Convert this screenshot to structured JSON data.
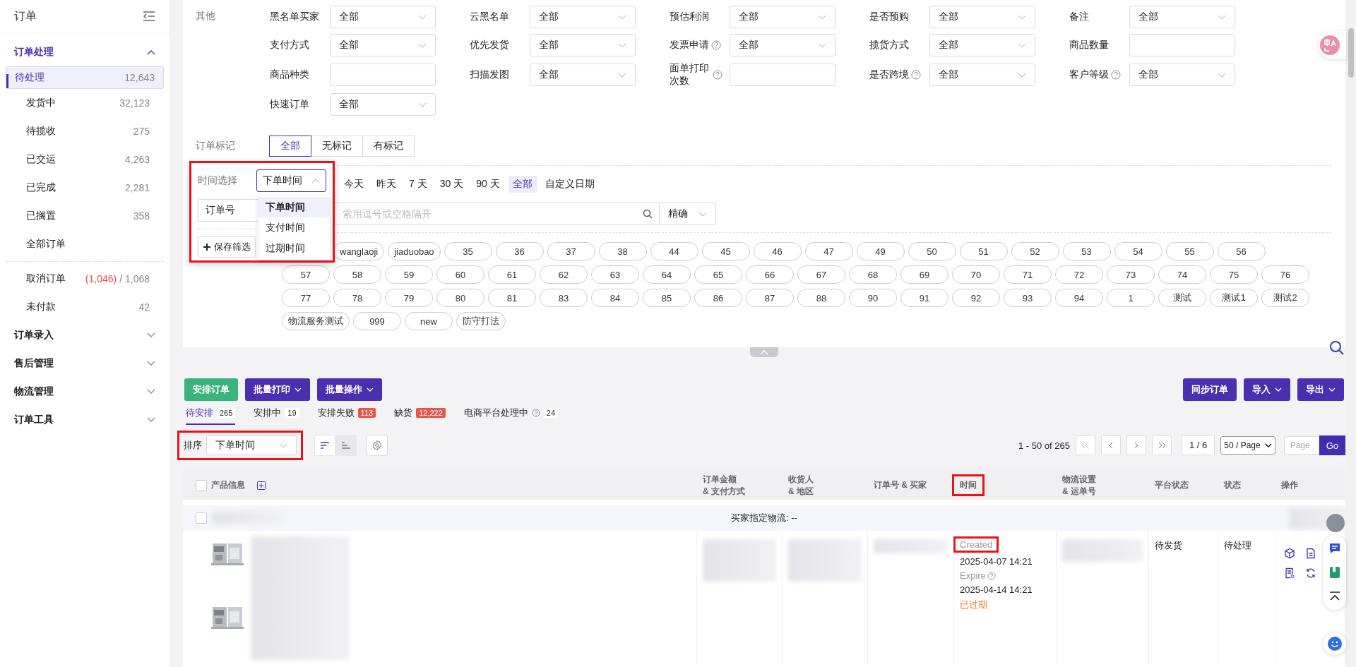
{
  "sidebar": {
    "title": "订单",
    "sections": [
      {
        "label": "订单处理",
        "expanded": true,
        "groups": [
          [
            {
              "label": "待处理",
              "count": "12,643",
              "selected": true
            },
            {
              "label": "发货中",
              "count": "32,123",
              "selected": false
            },
            {
              "label": "待揽收",
              "count": "275",
              "selected": false
            },
            {
              "label": "已交运",
              "count": "4,263",
              "selected": false
            },
            {
              "label": "已完成",
              "count": "2,281",
              "selected": false
            },
            {
              "label": "已搁置",
              "count": "358",
              "selected": false
            },
            {
              "label": "全部订单",
              "selected": false
            }
          ],
          [
            {
              "label": "取消订单",
              "alert_count": "(1,046)",
              "count": "/ 1,068",
              "selected": false
            },
            {
              "label": "未付款",
              "count": "42",
              "selected": false
            }
          ]
        ]
      },
      {
        "label": "订单录入",
        "expanded": false
      },
      {
        "label": "售后管理",
        "expanded": false
      },
      {
        "label": "物流管理",
        "expanded": false
      },
      {
        "label": "订单工具",
        "expanded": false
      }
    ]
  },
  "filters": {
    "group_label": "其他",
    "fields": [
      {
        "label": "黑名单买家",
        "kind": "select",
        "value": "全部",
        "help": false
      },
      {
        "label": "云黑名单",
        "kind": "select",
        "value": "全部",
        "help": false
      },
      {
        "label": "预估利润",
        "kind": "select",
        "value": "全部",
        "help": false
      },
      {
        "label": "是否预购",
        "kind": "select",
        "value": "全部",
        "help": false
      },
      {
        "label": "备注",
        "kind": "select",
        "value": "全部",
        "help": false
      },
      {
        "label": "支付方式",
        "kind": "select",
        "value": "全部",
        "help": false
      },
      {
        "label": "优先发货",
        "kind": "select",
        "value": "全部",
        "help": false
      },
      {
        "label": "发票申请",
        "kind": "select",
        "value": "全部",
        "help": true
      },
      {
        "label": "揽货方式",
        "kind": "select",
        "value": "全部",
        "help": false
      },
      {
        "label": "商品数量",
        "kind": "input",
        "help": false
      },
      {
        "label": "商品种类",
        "kind": "input",
        "help": false
      },
      {
        "label": "扫描发图",
        "kind": "select",
        "value": "全部",
        "help": false
      },
      {
        "label": "面单打印次数",
        "kind": "input",
        "help": true
      },
      {
        "label": "是否跨境",
        "kind": "select",
        "value": "全部",
        "help": true
      },
      {
        "label": "客户等级",
        "kind": "select",
        "value": "全部",
        "help": true
      },
      {
        "label": "快速订单",
        "kind": "select",
        "value": "全部",
        "help": false
      }
    ]
  },
  "order_marks": {
    "label": "订单标记",
    "options": [
      {
        "label": "全部",
        "selected": true
      },
      {
        "label": "无标记",
        "selected": false
      },
      {
        "label": "有标记",
        "selected": false
      }
    ]
  },
  "time_popup": {
    "label": "时间选择",
    "value": "下单时间",
    "expanded": true,
    "highlighted": true,
    "options": [
      {
        "label": "下单时间",
        "selected": true
      },
      {
        "label": "支付时间",
        "selected": false
      },
      {
        "label": "过期时间",
        "selected": false
      }
    ],
    "search_type": "订单号",
    "save_button": "保存筛选"
  },
  "time_ranges": [
    {
      "label": "今天",
      "selected": false
    },
    {
      "label": "昨天",
      "selected": false
    },
    {
      "label": "7 天",
      "selected": false
    },
    {
      "label": "30 天",
      "selected": false
    },
    {
      "label": "90 天",
      "selected": false
    },
    {
      "label": "全部",
      "selected": true
    },
    {
      "label": "自定义日期",
      "selected": false
    }
  ],
  "search": {
    "placeholder": "索用逗号或空格隔开",
    "match": "精确"
  },
  "tag_rows": [
    [
      "wanglaoji",
      "jiaduobao",
      "35",
      "36",
      "37",
      "38",
      "44",
      "45",
      "46",
      "47",
      "49",
      "50",
      "51",
      "52",
      "53",
      "54",
      "55",
      "56"
    ],
    [
      "57",
      "58",
      "59",
      "60",
      "61",
      "62",
      "63",
      "64",
      "65",
      "66",
      "67",
      "68",
      "69",
      "70",
      "71",
      "72",
      "73",
      "74",
      "75",
      "76"
    ],
    [
      "77",
      "78",
      "79",
      "80",
      "81",
      "83",
      "84",
      "85",
      "86",
      "87",
      "88",
      "90",
      "91",
      "92",
      "93",
      "94",
      "1",
      "测试",
      "测试1",
      "测试2"
    ],
    [
      "物流服务测试",
      "999",
      "new",
      "防守打法"
    ]
  ],
  "actions": {
    "left": [
      {
        "label": "安排订单",
        "kind": "primary"
      },
      {
        "label": "批量打印",
        "kind": "menu"
      },
      {
        "label": "批量操作",
        "kind": "menu"
      }
    ],
    "right": [
      {
        "label": "同步订单",
        "kind": "plain"
      },
      {
        "label": "导入",
        "kind": "menu"
      },
      {
        "label": "导出",
        "kind": "menu"
      }
    ]
  },
  "status_tabs": [
    {
      "label": "待安排",
      "count": "265",
      "alert": false,
      "help": false,
      "selected": true
    },
    {
      "label": "安排中",
      "count": "19",
      "alert": false,
      "help": false,
      "selected": false
    },
    {
      "label": "安排失败",
      "count": "113",
      "alert": true,
      "help": false,
      "selected": false
    },
    {
      "label": "缺货",
      "count": "12,222",
      "alert": true,
      "help": false,
      "selected": false
    },
    {
      "label": "电商平台处理中",
      "count": "24",
      "alert": false,
      "help": true,
      "selected": false
    }
  ],
  "sort": {
    "label": "排序",
    "value": "下单时间",
    "highlighted": true,
    "buttons": [
      {
        "kind": "desc",
        "selected": true
      },
      {
        "kind": "asc",
        "selected": false
      }
    ]
  },
  "pagination": {
    "range": "1 - 50 of 265",
    "page": "1 / 6",
    "page_size": "50 / Page",
    "page_placeholder": "Page",
    "go": "Go"
  },
  "table": {
    "select_all_checked": false,
    "columns": [
      {
        "lines": [
          "产品信息"
        ],
        "kind": "product",
        "highlighted": false
      },
      {
        "lines": [
          "订单金额",
          "& 支付方式"
        ],
        "kind": "text",
        "highlighted": false
      },
      {
        "lines": [
          "收货人",
          "& 地区"
        ],
        "kind": "text",
        "highlighted": false
      },
      {
        "lines": [
          "订单号 & 买家"
        ],
        "kind": "text",
        "highlighted": false
      },
      {
        "lines": [
          "时间"
        ],
        "kind": "text",
        "highlighted": true
      },
      {
        "lines": [
          "物流设置",
          "& 运单号"
        ],
        "kind": "text",
        "highlighted": false
      },
      {
        "lines": [
          "平台状态"
        ],
        "kind": "text",
        "highlighted": false
      },
      {
        "lines": [
          "状态"
        ],
        "kind": "text",
        "highlighted": false
      },
      {
        "lines": [
          "操作"
        ],
        "kind": "text",
        "highlighted": false
      }
    ],
    "group_label": "买家指定物流: --",
    "group_checked": false,
    "rows": [
      {
        "created_label": "Created",
        "created_highlighted": true,
        "created": "2025-04-07 14:21",
        "expire_label": "Expire",
        "expire": "2025-04-14 14:21",
        "time_status": "已过期",
        "platform_status": "待发货",
        "status": "待处理"
      }
    ]
  }
}
